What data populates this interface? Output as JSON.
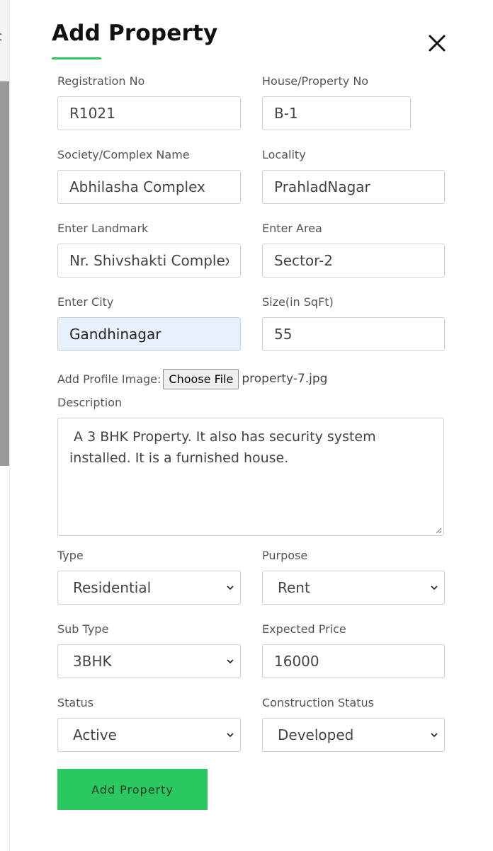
{
  "background": {
    "partial_text": "t"
  },
  "modal": {
    "title": "Add Property",
    "accent_color": "#2bc760",
    "close_icon": "close-icon"
  },
  "fields": {
    "registration_no": {
      "label": "Registration No",
      "value": "R1021"
    },
    "house_no": {
      "label": "House/Property No",
      "value": "B-1"
    },
    "society": {
      "label": "Society/Complex Name",
      "value": "Abhilasha Complex"
    },
    "locality": {
      "label": "Locality",
      "value": "PrahladNagar"
    },
    "landmark": {
      "label": "Enter Landmark",
      "value": "Nr. Shivshakti Complex"
    },
    "area": {
      "label": "Enter Area",
      "value": "Sector-2"
    },
    "city": {
      "label": "Enter City",
      "value": "Gandhinagar"
    },
    "size": {
      "label": "Size(in SqFt)",
      "value": "55"
    },
    "profile_image": {
      "label": "Add Profile Image:",
      "button": "Choose File",
      "file_name": "property-7.jpg"
    },
    "description": {
      "label": "Description",
      "value": " A 3 BHK Property. It also has security system installed. It is a furnished house."
    },
    "type": {
      "label": "Type",
      "value": "Residential"
    },
    "purpose": {
      "label": "Purpose",
      "value": "Rent"
    },
    "sub_type": {
      "label": "Sub Type",
      "value": "3BHK"
    },
    "expected_price": {
      "label": "Expected Price",
      "value": "16000"
    },
    "status": {
      "label": "Status",
      "value": "Active"
    },
    "construction_status": {
      "label": "Construction Status",
      "value": "Developed"
    }
  },
  "submit": {
    "label": "Add Property"
  }
}
